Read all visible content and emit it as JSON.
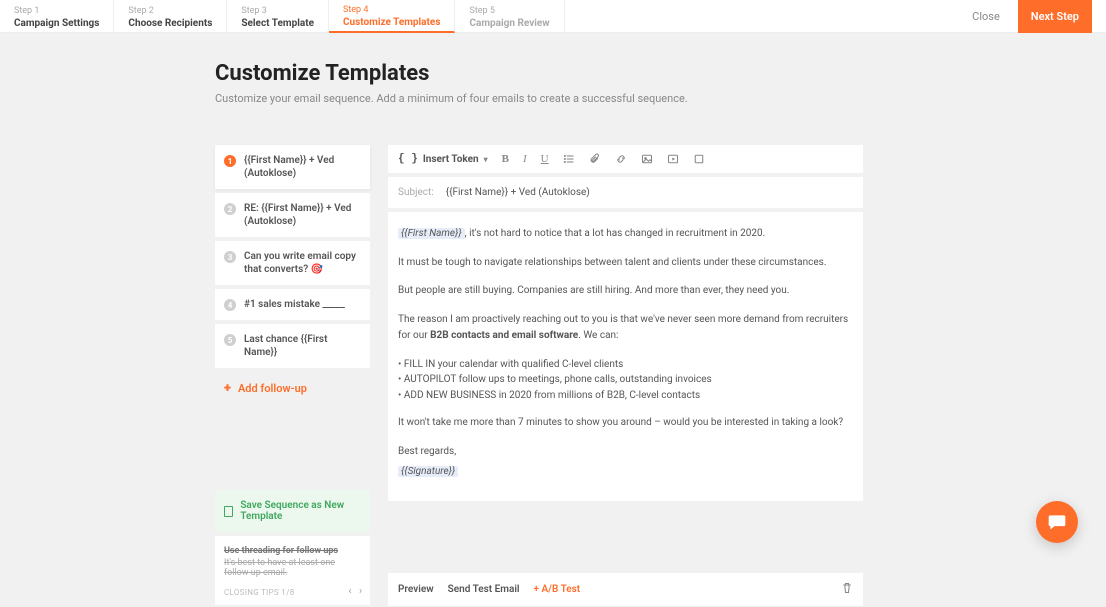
{
  "steps": [
    {
      "num": "Step 1",
      "title": "Campaign Settings"
    },
    {
      "num": "Step 2",
      "title": "Choose Recipients"
    },
    {
      "num": "Step 3",
      "title": "Select Template"
    },
    {
      "num": "Step 4",
      "title": "Customize Templates"
    },
    {
      "num": "Step 5",
      "title": "Campaign Review"
    }
  ],
  "actions": {
    "close": "Close",
    "next": "Next Step"
  },
  "heading": {
    "title": "Customize Templates",
    "subtitle": "Customize your email sequence. Add a minimum of four emails to create a successful sequence."
  },
  "emails": [
    {
      "badge": "1",
      "title": "{{First Name}} + Ved (Autoklose)"
    },
    {
      "badge": "2",
      "title": "RE: {{First Name}} + Ved (Autoklose)"
    },
    {
      "badge": "3",
      "title": "Can you write email copy that converts? 🎯"
    },
    {
      "badge": "4",
      "title": "#1 sales mistake _____"
    },
    {
      "badge": "5",
      "title": "Last chance {{First Name}}"
    }
  ],
  "add_follow": "Add follow-up",
  "save_seq": "Save Sequence as New Template",
  "tip": {
    "title": "Use threading for follow ups",
    "body": "It's best to have at least one follow up email.",
    "pager": "CLOSING TIPS 1/8",
    "prev": "‹",
    "next": "›"
  },
  "toolbar": {
    "insert_token": "Insert Token",
    "bold": "B",
    "italic": "I",
    "underline": "U"
  },
  "subject": {
    "label": "Subject:",
    "value": "{{First Name}} + Ved (Autoklose)"
  },
  "body": {
    "l1_token": "{{First Name}}",
    "l1_rest": ", it's not hard to notice that a lot has changed in recruitment in 2020.",
    "l2": "It must be tough to navigate relationships between talent and clients under these circumstances.",
    "l3": "But people are still buying. Companies are still hiring. And more than ever, they need you.",
    "l4a": "The reason I am proactively reaching out to you is that we've never seen more demand from recruiters for our ",
    "l4b": "B2B contacts and email software",
    "l4c": ". We can:",
    "b1": "• FILL IN your calendar with qualified C-level clients",
    "b2": "• AUTOPILOT follow ups to meetings, phone calls, outstanding invoices",
    "b3": "• ADD NEW BUSINESS in 2020 from millions of B2B, C-level contacts",
    "l5": "It won't take me more than 7 minutes to show you around – would you be interested in taking a look?",
    "l6": "Best regards,",
    "sig_token": "{{Signature}}"
  },
  "footer": {
    "preview": "Preview",
    "send_test": "Send Test Email",
    "ab": "+ A/B Test"
  }
}
